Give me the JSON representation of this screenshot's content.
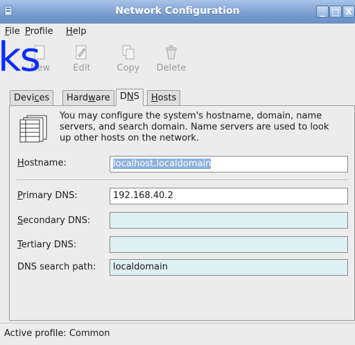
{
  "window": {
    "title": "Network Configuration",
    "controls": {
      "minimize": "_",
      "maximize": "□",
      "close": "X"
    }
  },
  "menubar": {
    "file": "File",
    "profile": "Profile",
    "help": "Help"
  },
  "overlay_text": "ks",
  "toolbar": {
    "new_label": "New",
    "edit_label": "Edit",
    "copy_label": "Copy",
    "delete_label": "Delete"
  },
  "tabs": {
    "devices": "Devices",
    "hardware": "Hardware",
    "dns": "DNS",
    "hosts": "Hosts",
    "active": "DNS"
  },
  "dns_panel": {
    "info_text": "You may configure the system's hostname, domain, name servers, and search domain. Name servers are used to look up other hosts on the network.",
    "hostname_label": "Hostname:",
    "hostname_value": "localhost.localdomain",
    "primary_label": "Primary DNS:",
    "primary_value": "192.168.40.2",
    "secondary_label": "Secondary DNS:",
    "secondary_value": "",
    "tertiary_label": "Tertiary DNS:",
    "tertiary_value": "",
    "search_label": "DNS search path:",
    "search_value": "localdomain"
  },
  "statusbar": {
    "text": "Active profile: Common"
  },
  "colors": {
    "titlebar": "#7d9fd0",
    "overlay": "#0a2cff",
    "field_blue": "#dff0f3",
    "selection": "#8fb0de"
  }
}
